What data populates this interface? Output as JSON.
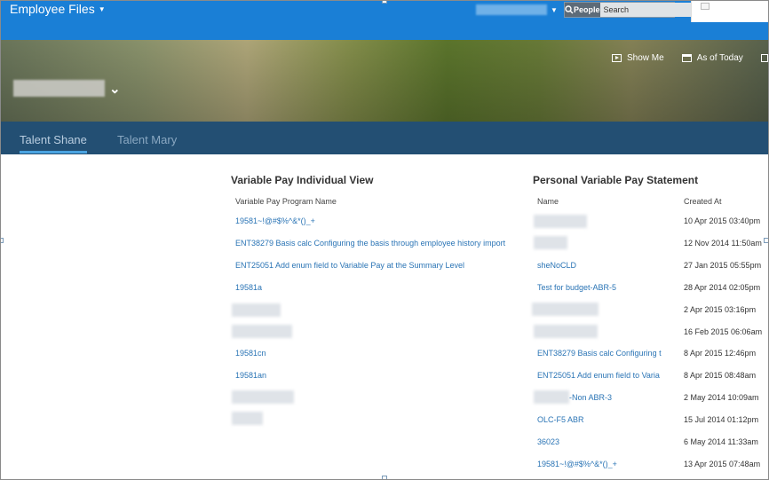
{
  "app": {
    "title": "Employee Files"
  },
  "search": {
    "people_label": "People",
    "placeholder": "Search"
  },
  "banner": {
    "show_me": "Show Me",
    "as_of_today": "As of Today"
  },
  "tabs": [
    {
      "label": "Talent Shane",
      "active": true
    },
    {
      "label": "Talent Mary",
      "active": false
    }
  ],
  "variable_pay": {
    "title": "Variable Pay Individual View",
    "column": "Variable Pay Program Name",
    "items": [
      "19581~!@#$%^&*()_+",
      "ENT38279 Basis calc Configuring the basis through employee history import",
      "ENT25051 Add enum field to Variable Pay at the Summary Level",
      "19581a",
      "",
      "",
      "19581cn",
      "19581an",
      "",
      ""
    ]
  },
  "statement": {
    "title": "Personal Variable Pay Statement",
    "col_name": "Name",
    "col_created": "Created At",
    "rows": [
      {
        "name": "",
        "created": "10 Apr 2015 03:40pm"
      },
      {
        "name": "",
        "created": "12 Nov 2014 11:50am"
      },
      {
        "name": "sheNoCLD",
        "created": "27 Jan 2015 05:55pm"
      },
      {
        "name": "Test for budget-ABR-5",
        "created": "28 Apr 2014 02:05pm"
      },
      {
        "name": "",
        "created": "2 Apr 2015 03:16pm"
      },
      {
        "name": "",
        "created": "16 Feb 2015 06:06am"
      },
      {
        "name": "ENT38279 Basis calc Configuring t",
        "created": "8 Apr 2015 12:46pm"
      },
      {
        "name": "ENT25051 Add enum field to Varia",
        "created": "8 Apr 2015 08:48am"
      },
      {
        "name": "-Non ABR-3",
        "created": "2 May 2014 10:09am"
      },
      {
        "name": "OLC-F5 ABR",
        "created": "15 Jul 2014 01:12pm"
      },
      {
        "name": "36023",
        "created": "6 May 2014 11:33am"
      },
      {
        "name": "19581~!@#$%^&*()_+",
        "created": "13 Apr 2015 07:48am"
      }
    ]
  },
  "colors": {
    "topbar": "#1a7fd6",
    "tabbar": "#234f73",
    "link": "#2a74b5"
  }
}
